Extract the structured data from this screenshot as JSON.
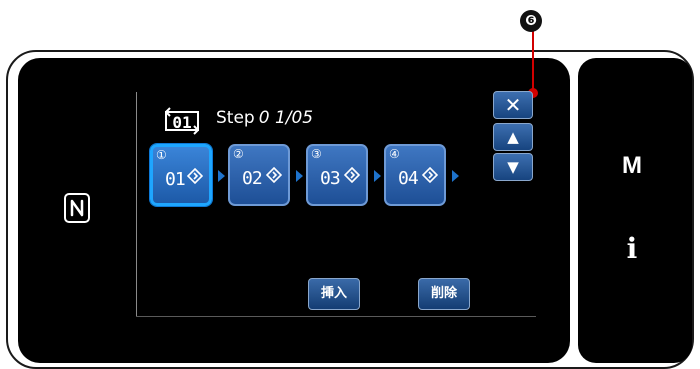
{
  "callout": {
    "number": "❻"
  },
  "step": {
    "label": "Step",
    "value": "0 1/05",
    "icon_text": "01"
  },
  "steps": [
    {
      "index": "①",
      "code": "01",
      "selected": true
    },
    {
      "index": "②",
      "code": "02",
      "selected": false
    },
    {
      "index": "③",
      "code": "03",
      "selected": false
    },
    {
      "index": "④",
      "code": "04",
      "selected": false
    }
  ],
  "buttons": {
    "close": "✕",
    "up": "▲",
    "down": "▼",
    "insert": "挿入",
    "delete": "削除"
  },
  "side": {
    "menu": "M",
    "info": "i"
  },
  "icons": {
    "nfc": "nfc-icon",
    "step": "step-cycle-icon",
    "diamond": "diamond-arrow-icon"
  },
  "colors": {
    "accent": "#1ea6ff",
    "step_block": "#2e63ad",
    "callout": "#d10000"
  }
}
